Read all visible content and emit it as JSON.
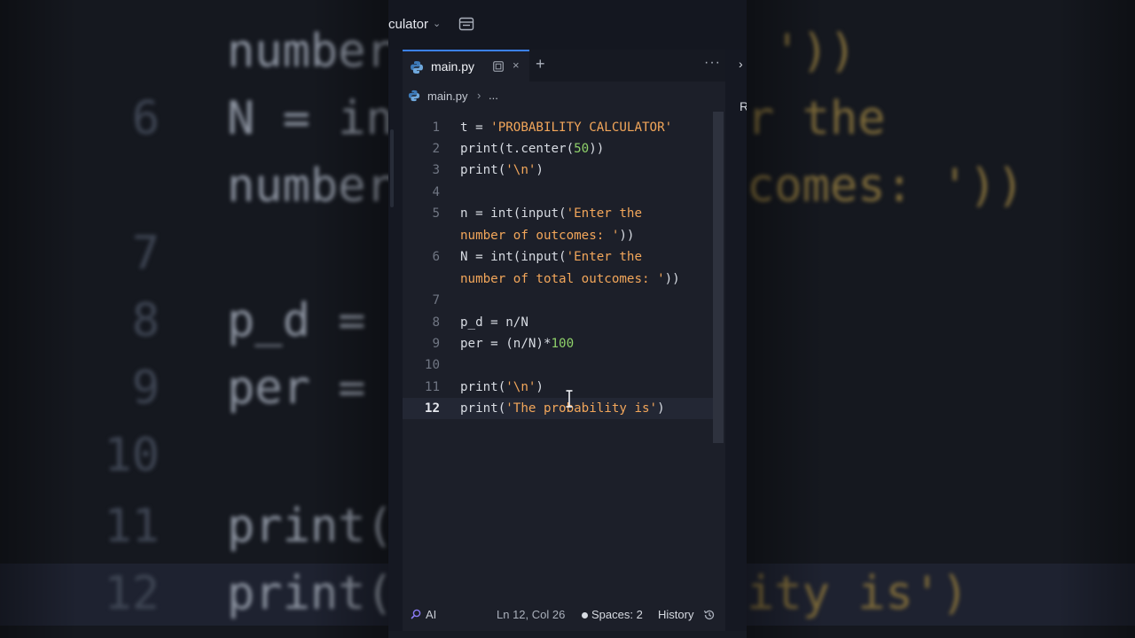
{
  "app": {
    "project_name": "culator",
    "tab": {
      "label": "main.py"
    },
    "breadcrumb": {
      "file": "main.py",
      "separator": "›",
      "more": "..."
    },
    "icons": {
      "tab_close": "×",
      "add_tab": "+",
      "more": "···",
      "chevron": "⌄",
      "right_close": "›"
    },
    "right_panel_letter": "R",
    "code_lines": [
      {
        "n": "1",
        "parts": [
          [
            "t = ",
            "p"
          ],
          [
            "'PROBABILITY CALCULATOR'",
            "s"
          ]
        ]
      },
      {
        "n": "2",
        "parts": [
          [
            "print(t.center(",
            "p"
          ],
          [
            "50",
            "n"
          ],
          [
            "))",
            "p"
          ]
        ]
      },
      {
        "n": "3",
        "parts": [
          [
            "print(",
            "p"
          ],
          [
            "'\\n'",
            "s"
          ],
          [
            ")",
            "p"
          ]
        ]
      },
      {
        "n": "4",
        "parts": []
      },
      {
        "n": "5",
        "parts": [
          [
            "n = int(input(",
            "p"
          ],
          [
            "'Enter the",
            "s"
          ]
        ]
      },
      {
        "n": "",
        "parts": [
          [
            "number of outcomes: '",
            "s"
          ],
          [
            "))",
            "p"
          ]
        ]
      },
      {
        "n": "6",
        "parts": [
          [
            "N = int(input(",
            "p"
          ],
          [
            "'Enter the",
            "s"
          ]
        ]
      },
      {
        "n": "",
        "parts": [
          [
            "number of total outcomes: '",
            "s"
          ],
          [
            "))",
            "p"
          ]
        ]
      },
      {
        "n": "7",
        "parts": []
      },
      {
        "n": "8",
        "parts": [
          [
            "p_d = n/N",
            "p"
          ]
        ]
      },
      {
        "n": "9",
        "parts": [
          [
            "per = (n/N)*",
            "p"
          ],
          [
            "100",
            "n"
          ]
        ]
      },
      {
        "n": "10",
        "parts": []
      },
      {
        "n": "11",
        "parts": [
          [
            "print(",
            "p"
          ],
          [
            "'\\n'",
            "s"
          ],
          [
            ")",
            "p"
          ]
        ]
      },
      {
        "n": "12",
        "parts": [
          [
            "print(",
            "p"
          ],
          [
            "'The probability is'",
            "s"
          ],
          [
            ")",
            "p"
          ]
        ]
      }
    ],
    "active_line": "12",
    "status": {
      "ai": "AI",
      "cursor": "Ln 12, Col 26",
      "spaces": "Spaces: 2",
      "history": "History"
    },
    "colors": {
      "accent": "#3b82f6",
      "string": "#f2a65a",
      "number": "#8fd16a",
      "plain": "#d7dbe2"
    }
  },
  "background": {
    "left": [
      {
        "num": "",
        "parts": [
          [
            "number",
            "p"
          ]
        ]
      },
      {
        "num": "6",
        "parts": [
          [
            "N = in",
            "p"
          ]
        ]
      },
      {
        "num": "",
        "parts": [
          [
            "number",
            "p"
          ]
        ]
      },
      {
        "num": "7",
        "parts": []
      },
      {
        "num": "8",
        "parts": [
          [
            "p_d = ",
            "p"
          ]
        ]
      },
      {
        "num": "9",
        "parts": [
          [
            "per = ",
            "p"
          ]
        ]
      },
      {
        "num": "10",
        "parts": []
      },
      {
        "num": "11",
        "parts": [
          [
            "print(",
            "p"
          ]
        ]
      },
      {
        "num": "12",
        "parts": [
          [
            "print(",
            "p"
          ]
        ]
      }
    ],
    "right": [
      {
        "parts": [
          [
            "'))",
            "s"
          ]
        ]
      },
      {
        "parts": [
          [
            "r the",
            "s"
          ]
        ]
      },
      {
        "parts": [
          [
            "comes: '))",
            "s"
          ]
        ]
      },
      {
        "parts": []
      },
      {
        "parts": []
      },
      {
        "parts": []
      },
      {
        "parts": []
      },
      {
        "parts": []
      },
      {
        "parts": [
          [
            "ity is')",
            "s"
          ]
        ]
      }
    ]
  }
}
